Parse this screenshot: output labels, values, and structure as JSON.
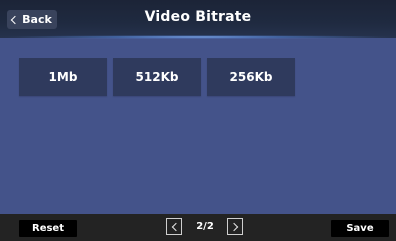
{
  "header": {
    "back_label": "Back",
    "title": "Video Bitrate"
  },
  "options": [
    {
      "label": "1Mb"
    },
    {
      "label": "512Kb"
    },
    {
      "label": "256Kb"
    }
  ],
  "footer": {
    "reset_label": "Reset",
    "page_indicator": "2/2",
    "save_label": "Save"
  },
  "icons": {
    "back": "chevron-left-icon",
    "prev": "chevron-left-icon",
    "next": "chevron-right-icon"
  },
  "colors": {
    "background": "#44538a",
    "header": "#1f2a40",
    "option_button": "#2f3a5d",
    "footer": "#232323"
  }
}
